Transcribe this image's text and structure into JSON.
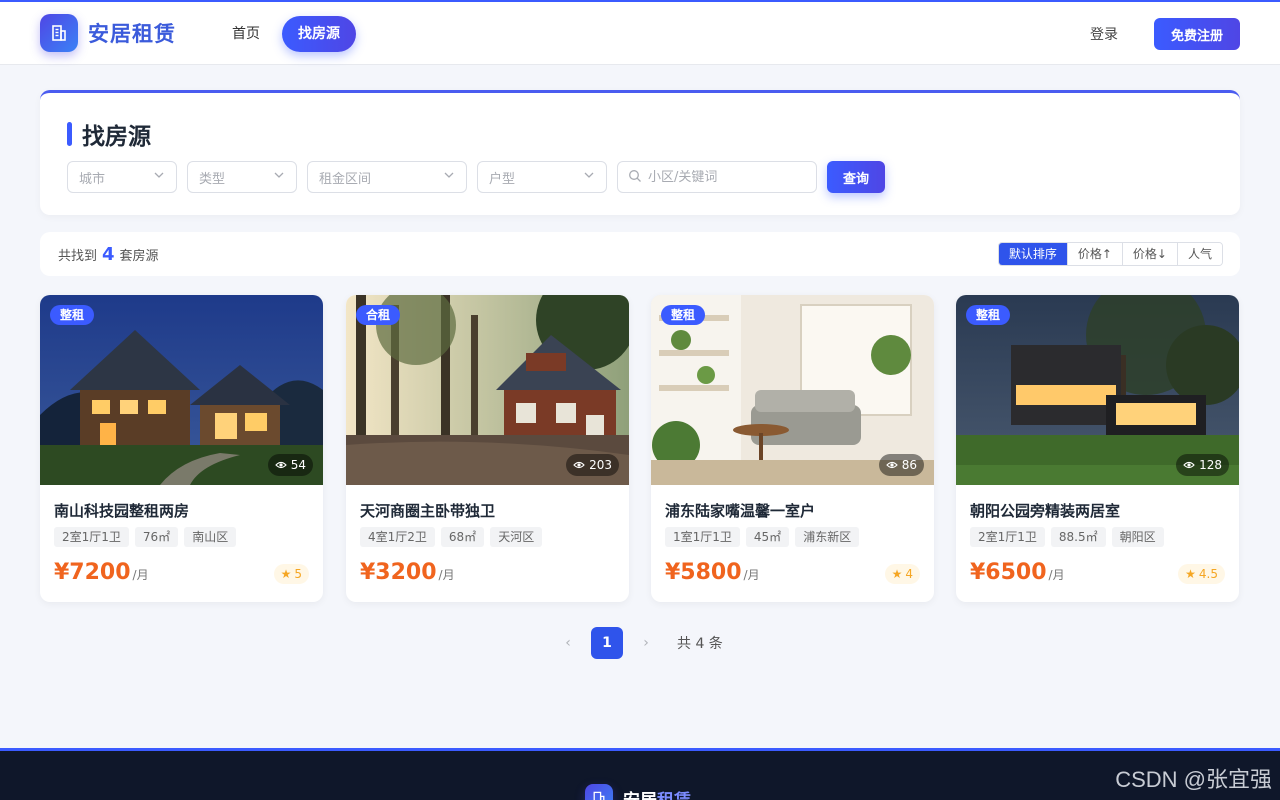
{
  "header": {
    "brand": "安居租赁",
    "nav": [
      {
        "label": "首页",
        "active": false
      },
      {
        "label": "找房源",
        "active": true
      }
    ],
    "login_label": "登录",
    "register_label": "免费注册"
  },
  "search": {
    "title": "找房源",
    "filters": [
      {
        "placeholder": "城市"
      },
      {
        "placeholder": "类型"
      },
      {
        "placeholder": "租金区间"
      },
      {
        "placeholder": "户型"
      }
    ],
    "keyword_placeholder": "小区/关键词",
    "query_label": "查询"
  },
  "results": {
    "prefix": "共找到",
    "count": "4",
    "suffix": "套房源",
    "sort_options": [
      {
        "label": "默认排序",
        "active": true
      },
      {
        "label": "价格↑",
        "active": false
      },
      {
        "label": "价格↓",
        "active": false
      },
      {
        "label": "人气",
        "active": false
      }
    ]
  },
  "listings": [
    {
      "badge": "整租",
      "views": "54",
      "title": "南山科技园整租两房",
      "tags": [
        "2室1厅1卫",
        "76㎡",
        "南山区"
      ],
      "price": "¥7200",
      "unit": "/月",
      "rating": "5"
    },
    {
      "badge": "合租",
      "views": "203",
      "title": "天河商圈主卧带独卫",
      "tags": [
        "4室1厅2卫",
        "68㎡",
        "天河区"
      ],
      "price": "¥3200",
      "unit": "/月",
      "rating": ""
    },
    {
      "badge": "整租",
      "views": "86",
      "title": "浦东陆家嘴温馨一室户",
      "tags": [
        "1室1厅1卫",
        "45㎡",
        "浦东新区"
      ],
      "price": "¥5800",
      "unit": "/月",
      "rating": "4"
    },
    {
      "badge": "整租",
      "views": "128",
      "title": "朝阳公园旁精装两居室",
      "tags": [
        "2室1厅1卫",
        "88.5㎡",
        "朝阳区"
      ],
      "price": "¥6500",
      "unit": "/月",
      "rating": "4.5"
    }
  ],
  "pagination": {
    "prev": "‹",
    "current": "1",
    "next": "›",
    "total": "共 4 条"
  },
  "footer": {
    "brand_a": "安居",
    "brand_b": "租赁"
  },
  "watermark": "CSDN @张宜强",
  "colors": {
    "primary": "#3b5bff",
    "price": "#f0641e",
    "rating": "#f5a623",
    "footer_bg": "#0f172a"
  },
  "icons": {
    "brand": "building-icon",
    "dropdown": "chevron-down-icon",
    "search": "search-icon",
    "views": "eye-icon",
    "rating": "star-icon"
  }
}
